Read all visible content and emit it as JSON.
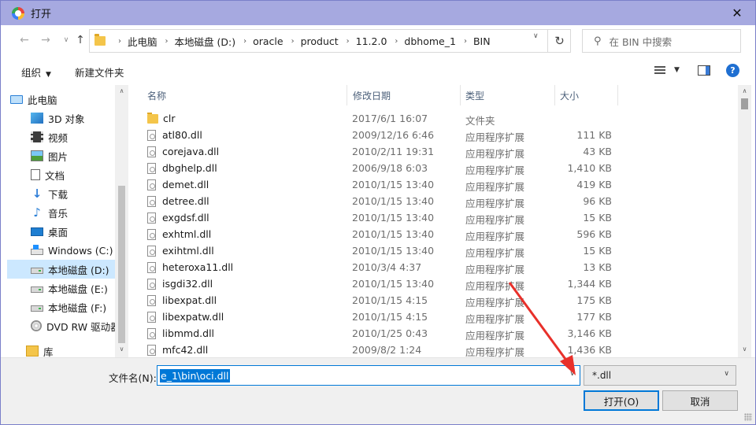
{
  "window": {
    "title": "打开",
    "close_glyph": "✕"
  },
  "nav": {
    "back_glyph": "←",
    "forward_glyph": "→",
    "up_glyph": "↑",
    "breadcrumbs": [
      "此电脑",
      "本地磁盘 (D:)",
      "oracle",
      "product",
      "11.2.0",
      "dbhome_1",
      "BIN"
    ],
    "refresh_glyph": "↻",
    "search_placeholder": "在 BIN 中搜索"
  },
  "toolbar": {
    "organize_label": "组织",
    "new_folder_label": "新建文件夹",
    "help_glyph": "?"
  },
  "sidebar": {
    "items": [
      {
        "label": "此电脑",
        "icon": "pc-icon"
      },
      {
        "label": "3D 对象",
        "icon": "3d-objects-icon"
      },
      {
        "label": "视频",
        "icon": "video-icon"
      },
      {
        "label": "图片",
        "icon": "pictures-icon"
      },
      {
        "label": "文档",
        "icon": "documents-icon"
      },
      {
        "label": "下载",
        "icon": "download-icon"
      },
      {
        "label": "音乐",
        "icon": "music-icon"
      },
      {
        "label": "桌面",
        "icon": "desktop-icon"
      },
      {
        "label": "Windows (C:)",
        "icon": "windows-drive-icon"
      },
      {
        "label": "本地磁盘 (D:)",
        "icon": "drive-icon",
        "selected": true
      },
      {
        "label": "本地磁盘 (E:)",
        "icon": "drive-icon"
      },
      {
        "label": "本地磁盘 (F:)",
        "icon": "drive-icon"
      },
      {
        "label": "DVD RW 驱动器",
        "icon": "dvd-icon"
      },
      {
        "label": "库",
        "icon": "library-icon"
      }
    ]
  },
  "filelist": {
    "columns": [
      "名称",
      "修改日期",
      "类型",
      "大小"
    ],
    "rows": [
      {
        "name": "clr",
        "date": "2017/6/1 16:07",
        "type": "文件夹",
        "size": "",
        "kind": "folder"
      },
      {
        "name": "atl80.dll",
        "date": "2009/12/16 6:46",
        "type": "应用程序扩展",
        "size": "111 KB",
        "kind": "file"
      },
      {
        "name": "corejava.dll",
        "date": "2010/2/11 19:31",
        "type": "应用程序扩展",
        "size": "43 KB",
        "kind": "file"
      },
      {
        "name": "dbghelp.dll",
        "date": "2006/9/18 6:03",
        "type": "应用程序扩展",
        "size": "1,410 KB",
        "kind": "file"
      },
      {
        "name": "demet.dll",
        "date": "2010/1/15 13:40",
        "type": "应用程序扩展",
        "size": "419 KB",
        "kind": "file"
      },
      {
        "name": "detree.dll",
        "date": "2010/1/15 13:40",
        "type": "应用程序扩展",
        "size": "96 KB",
        "kind": "file"
      },
      {
        "name": "exgdsf.dll",
        "date": "2010/1/15 13:40",
        "type": "应用程序扩展",
        "size": "15 KB",
        "kind": "file"
      },
      {
        "name": "exhtml.dll",
        "date": "2010/1/15 13:40",
        "type": "应用程序扩展",
        "size": "596 KB",
        "kind": "file"
      },
      {
        "name": "exihtml.dll",
        "date": "2010/1/15 13:40",
        "type": "应用程序扩展",
        "size": "15 KB",
        "kind": "file"
      },
      {
        "name": "heteroxa11.dll",
        "date": "2010/3/4 4:37",
        "type": "应用程序扩展",
        "size": "13 KB",
        "kind": "file"
      },
      {
        "name": "isgdi32.dll",
        "date": "2010/1/15 13:40",
        "type": "应用程序扩展",
        "size": "1,344 KB",
        "kind": "file"
      },
      {
        "name": "libexpat.dll",
        "date": "2010/1/15 4:15",
        "type": "应用程序扩展",
        "size": "175 KB",
        "kind": "file"
      },
      {
        "name": "libexpatw.dll",
        "date": "2010/1/15 4:15",
        "type": "应用程序扩展",
        "size": "177 KB",
        "kind": "file"
      },
      {
        "name": "libmmd.dll",
        "date": "2010/1/25 0:43",
        "type": "应用程序扩展",
        "size": "3,146 KB",
        "kind": "file"
      },
      {
        "name": "mfc42.dll",
        "date": "2009/8/2 1:24",
        "type": "应用程序扩展",
        "size": "1,436 KB",
        "kind": "file"
      }
    ]
  },
  "footer": {
    "filename_label": "文件名(N):",
    "filename_value": "e_1\\bin\\oci.dll",
    "filetype_value": "*.dll",
    "open_label": "打开(O)",
    "cancel_label": "取消"
  },
  "colors": {
    "titlebar": "#a6a9e0",
    "selection": "#cce8ff",
    "accent": "#0078d7",
    "annotation_arrow": "#e8302a"
  }
}
